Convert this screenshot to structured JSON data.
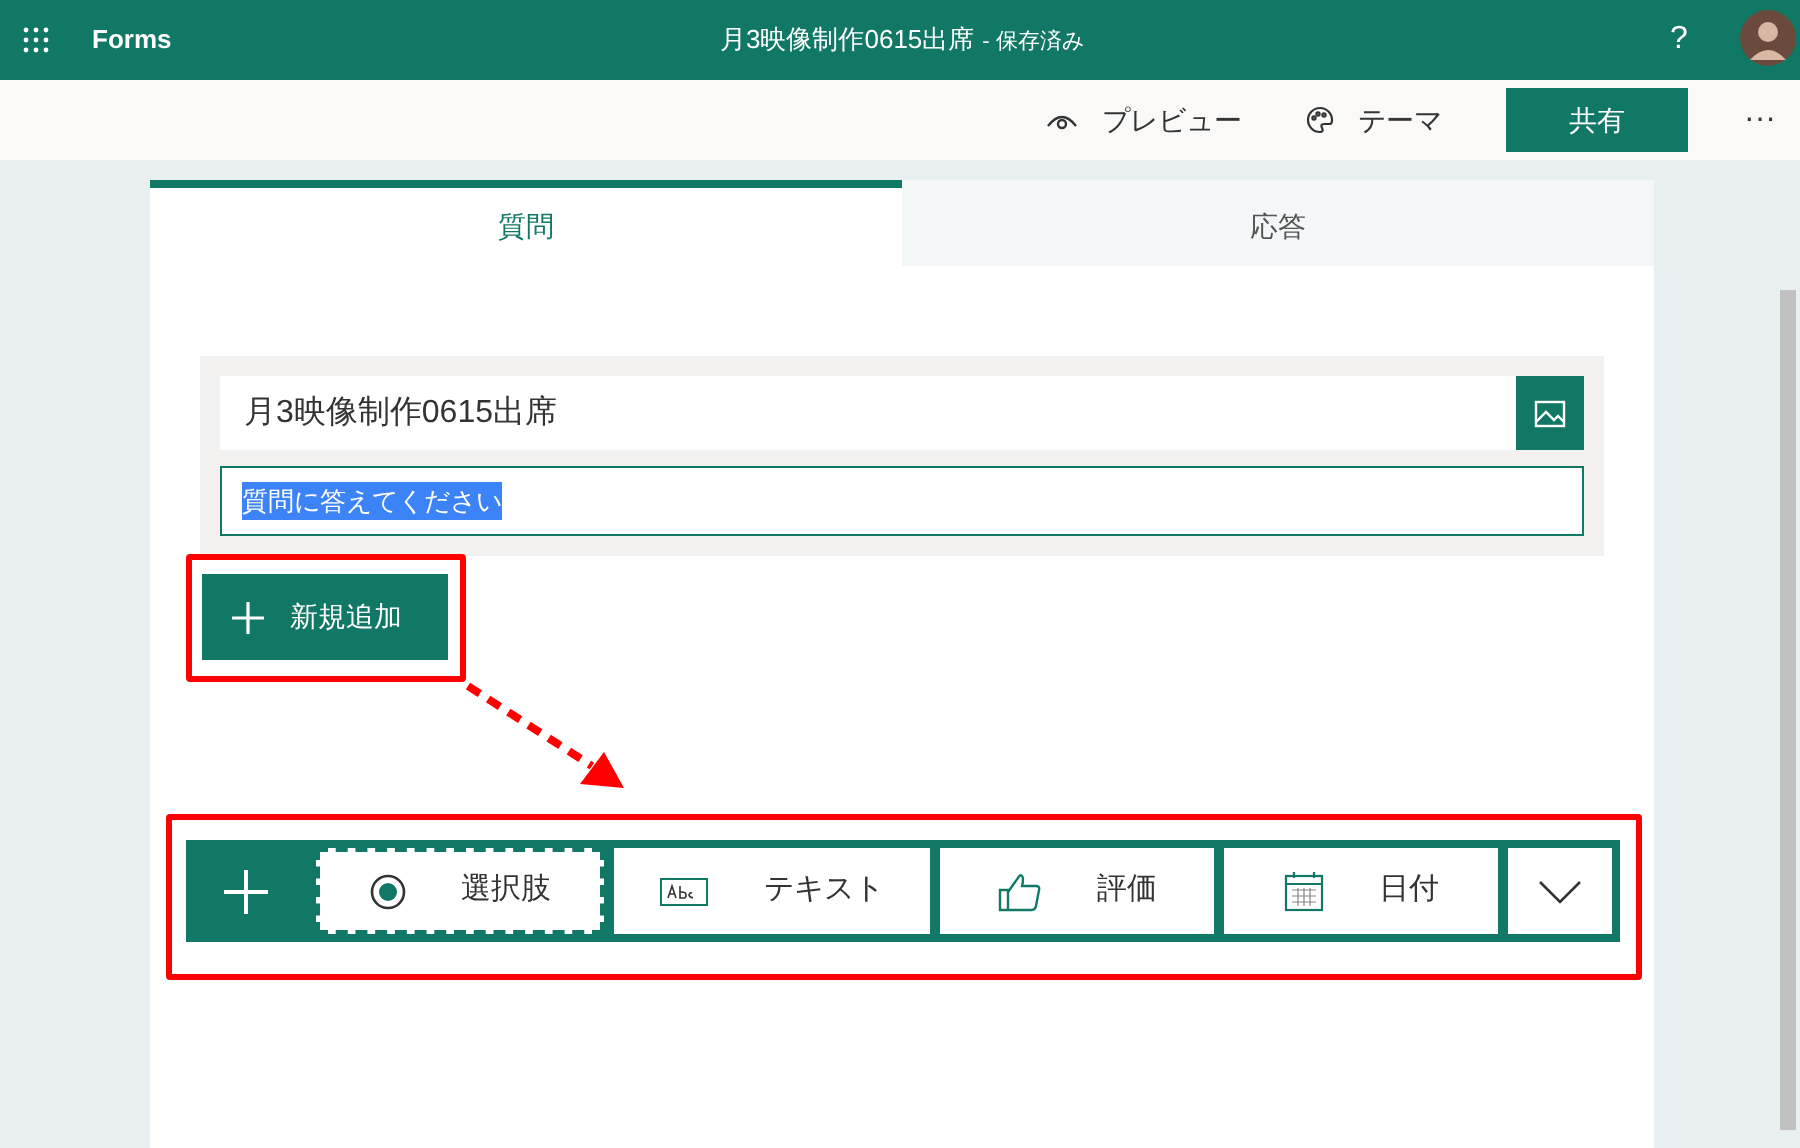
{
  "header": {
    "app_name": "Forms",
    "title": "月3映像制作0615出席",
    "status": "- 保存済み",
    "help": "?"
  },
  "toolbar": {
    "buttons": [
      {
        "kind": "preview",
        "label": "プレビュー"
      },
      {
        "kind": "theme",
        "label": "テーマ"
      },
      {
        "kind": "share",
        "label": "共有"
      },
      {
        "kind": "more",
        "label": "···"
      }
    ]
  },
  "tabs": [
    {
      "label": "質問",
      "selected": true
    },
    {
      "label": "応答",
      "selected": false
    }
  ],
  "form": {
    "title": "月3映像制作0615出席",
    "description": "質問に答えてください",
    "description_selected": true
  },
  "add_button": {
    "label": "新規追加",
    "highlighted": true
  },
  "question_types": {
    "highlighted": true,
    "items": [
      {
        "kind": "choice",
        "label": "選択肢",
        "focused": true
      },
      {
        "kind": "text",
        "label": "テキスト",
        "focused": false
      },
      {
        "kind": "rating",
        "label": "評価",
        "focused": false
      },
      {
        "kind": "date",
        "label": "日付",
        "focused": false
      },
      {
        "kind": "more",
        "focused": false
      }
    ]
  }
}
